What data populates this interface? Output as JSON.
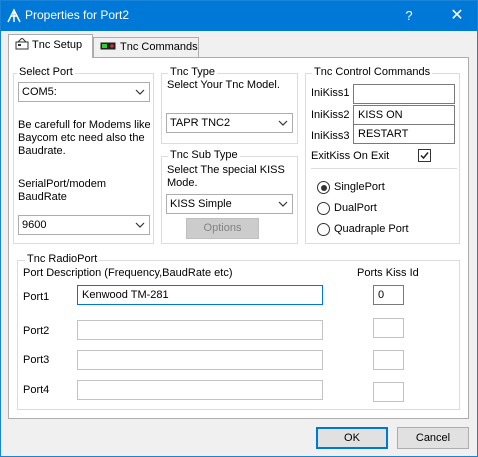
{
  "window": {
    "title": "Properties for Port2",
    "help_glyph": "?",
    "close_glyph": "✕"
  },
  "tabs": [
    {
      "label": "Tnc Setup",
      "icon": "tnc-icon"
    },
    {
      "label": "Tnc Commands",
      "icon": "radio-device-icon"
    }
  ],
  "select_port": {
    "legend": "Select Port",
    "value": "COM5:",
    "note": "Be carefull for Modems like Baycom etc need also the Baudrate.",
    "baud_label": "SerialPort/modem BaudRate",
    "baud_value": "9600"
  },
  "tnc_type": {
    "legend": "Tnc Type",
    "prompt": "Select Your Tnc Model.",
    "value": "TAPR TNC2"
  },
  "tnc_sub_type": {
    "legend": "Tnc Sub Type",
    "prompt": "Select The special KISS Mode.",
    "value": "KISS Simple",
    "options_button": "Options"
  },
  "tnc_control": {
    "legend": "Tnc Control Commands",
    "fields": [
      {
        "label": "IniKiss1",
        "value": ""
      },
      {
        "label": "IniKiss2",
        "value": "KISS ON"
      },
      {
        "label": "IniKiss3",
        "value": "RESTART"
      }
    ],
    "exit_label": "ExitKiss On Exit",
    "exit_checked": true,
    "port_modes": [
      {
        "label": "SinglePort",
        "selected": true
      },
      {
        "label": "DualPort",
        "selected": false
      },
      {
        "label": "Quadraple Port",
        "selected": false
      }
    ]
  },
  "radio_port": {
    "legend": "Tnc RadioPort",
    "desc_header": "Port Description (Frequency,BaudRate etc)",
    "kiss_header": "Ports Kiss Id",
    "ports": [
      {
        "label": "Port1",
        "description": "Kenwood TM-281",
        "kiss_id": "0"
      },
      {
        "label": "Port2",
        "description": "",
        "kiss_id": ""
      },
      {
        "label": "Port3",
        "description": "",
        "kiss_id": ""
      },
      {
        "label": "Port4",
        "description": "",
        "kiss_id": ""
      }
    ]
  },
  "buttons": {
    "ok": "OK",
    "cancel": "Cancel"
  }
}
